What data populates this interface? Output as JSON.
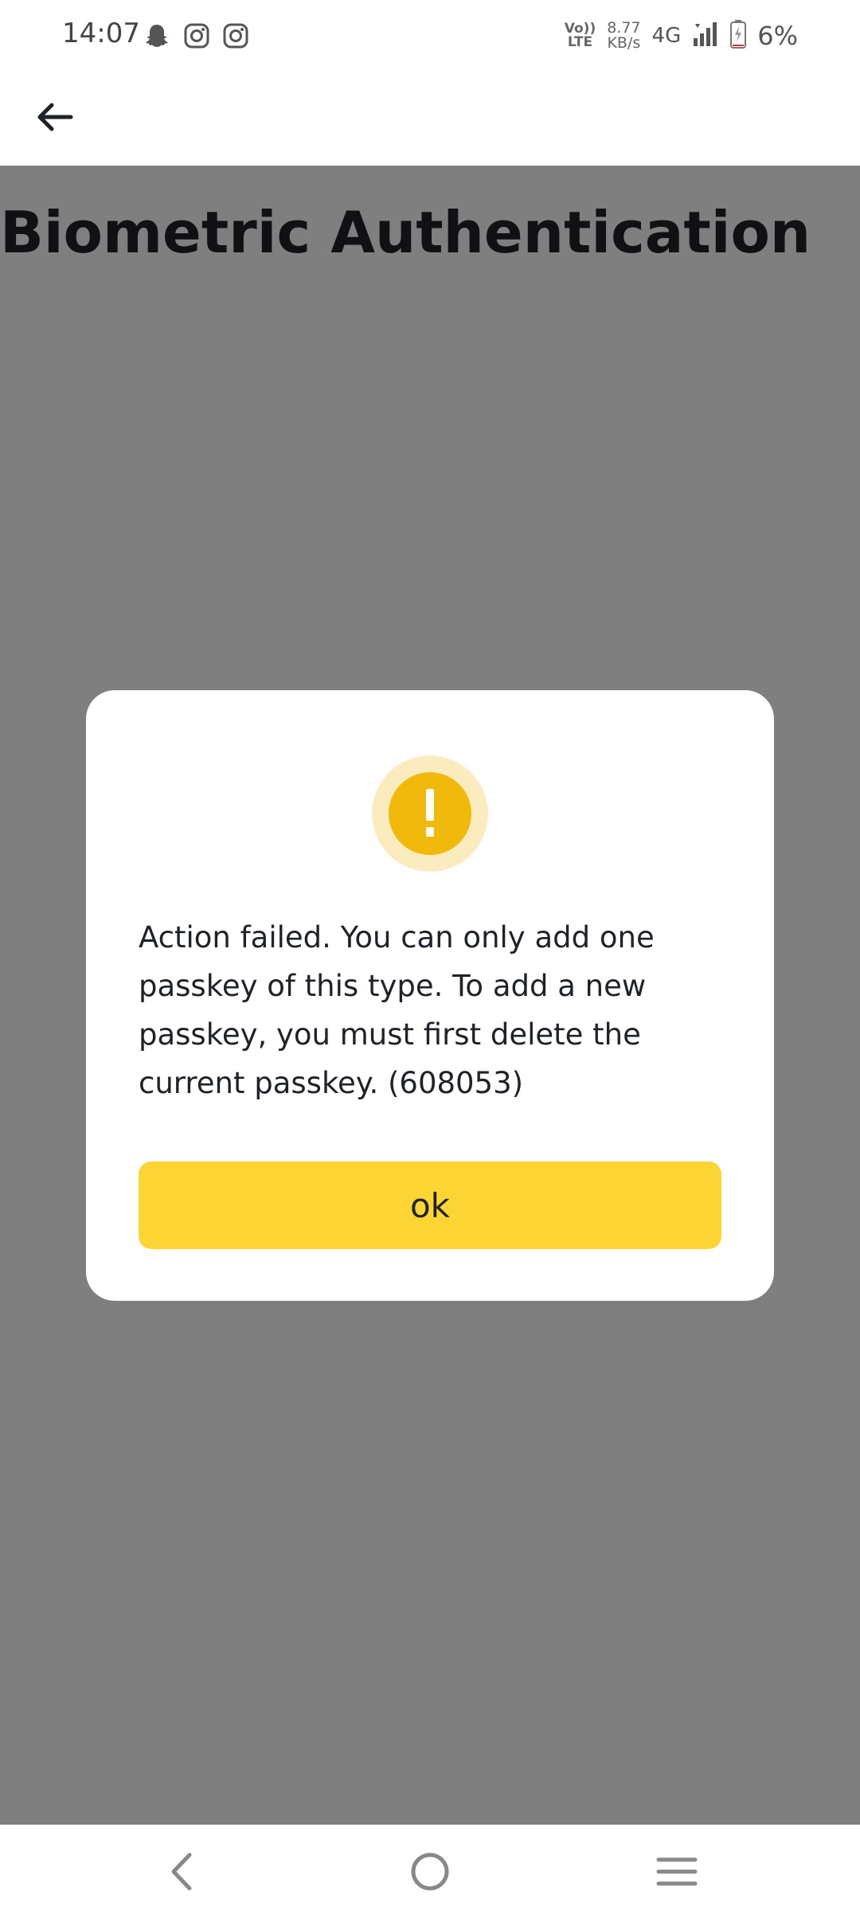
{
  "status_bar": {
    "time": "14:07",
    "notification_icons": [
      "snapchat-icon",
      "instagram-icon",
      "instagram-icon"
    ],
    "volte_top": "Vo))",
    "volte_bottom": "LTE",
    "speed_value": "8.77",
    "speed_unit": "KB/s",
    "network_type": "4G",
    "battery_percent": "6%",
    "battery_level": 0.06
  },
  "header": {
    "back_icon": "arrow-left-icon"
  },
  "page": {
    "title": "Biometric Authentication"
  },
  "dialog": {
    "icon": "warning-icon",
    "message": "Action failed. You can only add one passkey of this type. To add a new passkey, you must first delete the current passkey. (608053)",
    "ok_label": "ok"
  },
  "nav_bar": {
    "icons": [
      "back-triangle-icon",
      "home-circle-icon",
      "menu-lines-icon"
    ]
  },
  "colors": {
    "accent": "#fcd535",
    "warning": "#f0b90b",
    "warning_halo": "#fbecc0",
    "text": "#1e2329",
    "overlay": "rgba(0,0,0,0.5)"
  }
}
